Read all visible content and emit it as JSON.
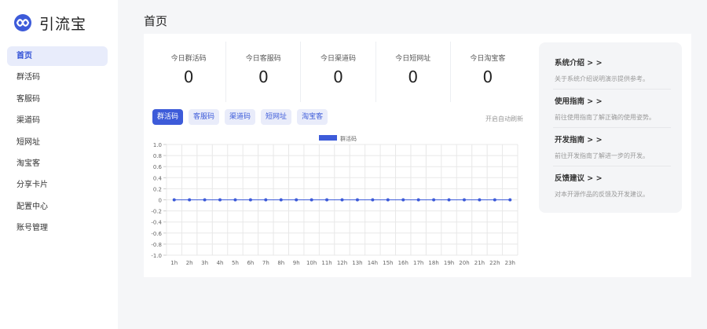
{
  "app": {
    "name": "引流宝",
    "logo_icon": "infinity-logo-icon"
  },
  "sidebar": {
    "items": [
      {
        "label": "首页",
        "active": true
      },
      {
        "label": "群活码",
        "active": false
      },
      {
        "label": "客服码",
        "active": false
      },
      {
        "label": "渠道码",
        "active": false
      },
      {
        "label": "短网址",
        "active": false
      },
      {
        "label": "淘宝客",
        "active": false
      },
      {
        "label": "分享卡片",
        "active": false
      },
      {
        "label": "配置中心",
        "active": false
      },
      {
        "label": "账号管理",
        "active": false
      }
    ]
  },
  "header": {
    "title": "首页"
  },
  "stats": [
    {
      "label": "今日群活码",
      "value": "0"
    },
    {
      "label": "今日客服码",
      "value": "0"
    },
    {
      "label": "今日渠道码",
      "value": "0"
    },
    {
      "label": "今日短网址",
      "value": "0"
    },
    {
      "label": "今日淘宝客",
      "value": "0"
    }
  ],
  "tabs": [
    {
      "label": "群活码",
      "active": true
    },
    {
      "label": "客服码",
      "active": false
    },
    {
      "label": "渠道码",
      "active": false
    },
    {
      "label": "短网址",
      "active": false
    },
    {
      "label": "淘宝客",
      "active": false
    }
  ],
  "auto_refresh_label": "开启自动刷新",
  "chart_data": {
    "type": "line",
    "categories": [
      "1h",
      "2h",
      "3h",
      "4h",
      "5h",
      "6h",
      "7h",
      "8h",
      "9h",
      "10h",
      "11h",
      "12h",
      "13h",
      "14h",
      "15h",
      "16h",
      "17h",
      "18h",
      "19h",
      "20h",
      "21h",
      "22h",
      "23h"
    ],
    "series": [
      {
        "name": "群活码",
        "color": "#3d5bd9",
        "values": [
          0,
          0,
          0,
          0,
          0,
          0,
          0,
          0,
          0,
          0,
          0,
          0,
          0,
          0,
          0,
          0,
          0,
          0,
          0,
          0,
          0,
          0,
          0
        ]
      }
    ],
    "yticks": [
      "1.0",
      "0.8",
      "0.6",
      "0.4",
      "0.2",
      "0",
      "-0.2",
      "-0.4",
      "-0.6",
      "-0.8",
      "-1.0"
    ],
    "ylim": [
      -1,
      1
    ],
    "grid": true,
    "legend": "top-center"
  },
  "side_panel": [
    {
      "title": "系统介绍 > >",
      "desc": "关于系统介绍说明演示提供参考。"
    },
    {
      "title": "使用指南 > >",
      "desc": "前往使用指南了解正确的使用姿势。"
    },
    {
      "title": "开发指南 > >",
      "desc": "前往开发指南了解进一步的开发。"
    },
    {
      "title": "反馈建议 > >",
      "desc": "对本开源作品的反馈及开发建议。"
    }
  ],
  "colors": {
    "accent": "#3d5bd9",
    "accent_light": "#e9ecfa",
    "background": "#f5f6f8"
  }
}
